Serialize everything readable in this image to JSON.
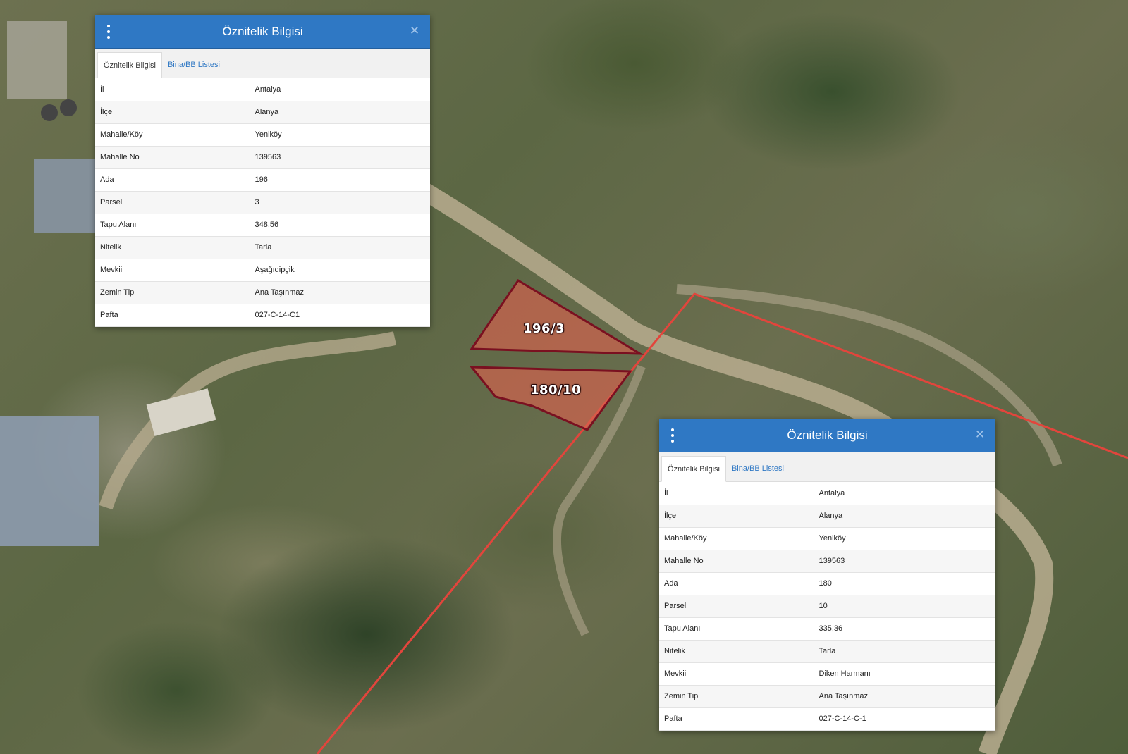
{
  "map": {
    "parcels": [
      {
        "label": "196/3",
        "fill": "#d9624f",
        "stroke": "#7a1020"
      },
      {
        "label": "180/10",
        "fill": "#d9624f",
        "stroke": "#7a1020"
      }
    ],
    "boundary_color": "#e2453c"
  },
  "panels": [
    {
      "title": "Öznitelik Bilgisi",
      "tabs": [
        "Öznitelik Bilgisi",
        "Bina/BB Listesi"
      ],
      "rows": [
        {
          "key": "İl",
          "value": "Antalya"
        },
        {
          "key": "İlçe",
          "value": "Alanya"
        },
        {
          "key": "Mahalle/Köy",
          "value": "Yeniköy"
        },
        {
          "key": "Mahalle No",
          "value": "139563"
        },
        {
          "key": "Ada",
          "value": "196"
        },
        {
          "key": "Parsel",
          "value": "3"
        },
        {
          "key": "Tapu Alanı",
          "value": "348,56"
        },
        {
          "key": "Nitelik",
          "value": "Tarla"
        },
        {
          "key": "Mevkii",
          "value": "Aşağıdipçik"
        },
        {
          "key": "Zemin Tip",
          "value": "Ana Taşınmaz"
        },
        {
          "key": "Pafta",
          "value": "027-C-14-C1"
        }
      ]
    },
    {
      "title": "Öznitelik Bilgisi",
      "tabs": [
        "Öznitelik Bilgisi",
        "Bina/BB Listesi"
      ],
      "rows": [
        {
          "key": "İl",
          "value": "Antalya"
        },
        {
          "key": "İlçe",
          "value": "Alanya"
        },
        {
          "key": "Mahalle/Köy",
          "value": "Yeniköy"
        },
        {
          "key": "Mahalle No",
          "value": "139563"
        },
        {
          "key": "Ada",
          "value": "180"
        },
        {
          "key": "Parsel",
          "value": "10"
        },
        {
          "key": "Tapu Alanı",
          "value": "335,36"
        },
        {
          "key": "Nitelik",
          "value": "Tarla"
        },
        {
          "key": "Mevkii",
          "value": "Diken Harmanı"
        },
        {
          "key": "Zemin Tip",
          "value": "Ana Taşınmaz"
        },
        {
          "key": "Pafta",
          "value": "027-C-14-C-1"
        }
      ]
    }
  ]
}
